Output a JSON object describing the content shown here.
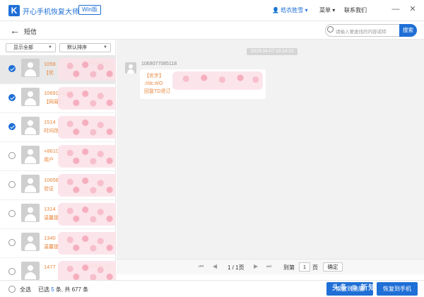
{
  "titlebar": {
    "app_title": "开心手机恢复大师",
    "badge": "Win版",
    "user_name": "皓衣胜雪",
    "user_caret": "▾",
    "menu_label": "菜单",
    "menu_caret": "▾",
    "contact_label": "联系我们",
    "minimize": "—",
    "close": "✕"
  },
  "header": {
    "title": "短信",
    "back": "←",
    "search_placeholder": "请输入要查找的内容或特",
    "search_button": "搜索"
  },
  "filters": {
    "show": "显示全部",
    "sort": "默认排序",
    "caret": "▼"
  },
  "conversations": [
    {
      "name": "1059",
      "date": "2019-04-07",
      "preview": "【优",
      "checked": true,
      "active": true
    },
    {
      "name": "1069124313",
      "date": "",
      "preview": "【网易】",
      "checked": true,
      "active": false
    },
    {
      "name": "1514",
      "date": "",
      "preview": "时间改",
      "checked": true,
      "active": false
    },
    {
      "name": "+8610",
      "date": "",
      "preview": "用户",
      "checked": false,
      "active": false
    },
    {
      "name": "10658",
      "date": "",
      "preview": "验证",
      "checked": false,
      "active": false
    },
    {
      "name": "1314",
      "date": "",
      "preview": "温馨提",
      "checked": false,
      "active": false
    },
    {
      "name": "1340",
      "date": "",
      "preview": "温馨提",
      "checked": false,
      "active": false
    },
    {
      "name": "1477",
      "date": "2019-04-07",
      "preview": "",
      "checked": false,
      "active": false
    }
  ],
  "message": {
    "date": "2019-04-07 13:14:13",
    "sender": "1069077085118",
    "lines": [
      "【优步】 ",
      "://dc.tt/O",
      "回复TD退订"
    ]
  },
  "pagination": {
    "first": "⏮",
    "prev": "◀",
    "info": "1 / 1页",
    "next": "▶",
    "last": "⏭",
    "goto_label": "到第",
    "page_value": "1",
    "page_unit": "页",
    "confirm": "确定"
  },
  "footer": {
    "select_all": "全选",
    "count_prefix": "已选 ",
    "selected": "5",
    "count_mid": " 条, 共 ",
    "total": "677",
    "count_suffix": " 条",
    "restore_pc": "恢复到电脑",
    "restore_phone": "恢复到手机",
    "watermark": "头条 @ 新知"
  },
  "colors": {
    "accent": "#1f6fd6",
    "highlight_text": "#e8853c",
    "mask_pink": "#f6a6b8"
  }
}
